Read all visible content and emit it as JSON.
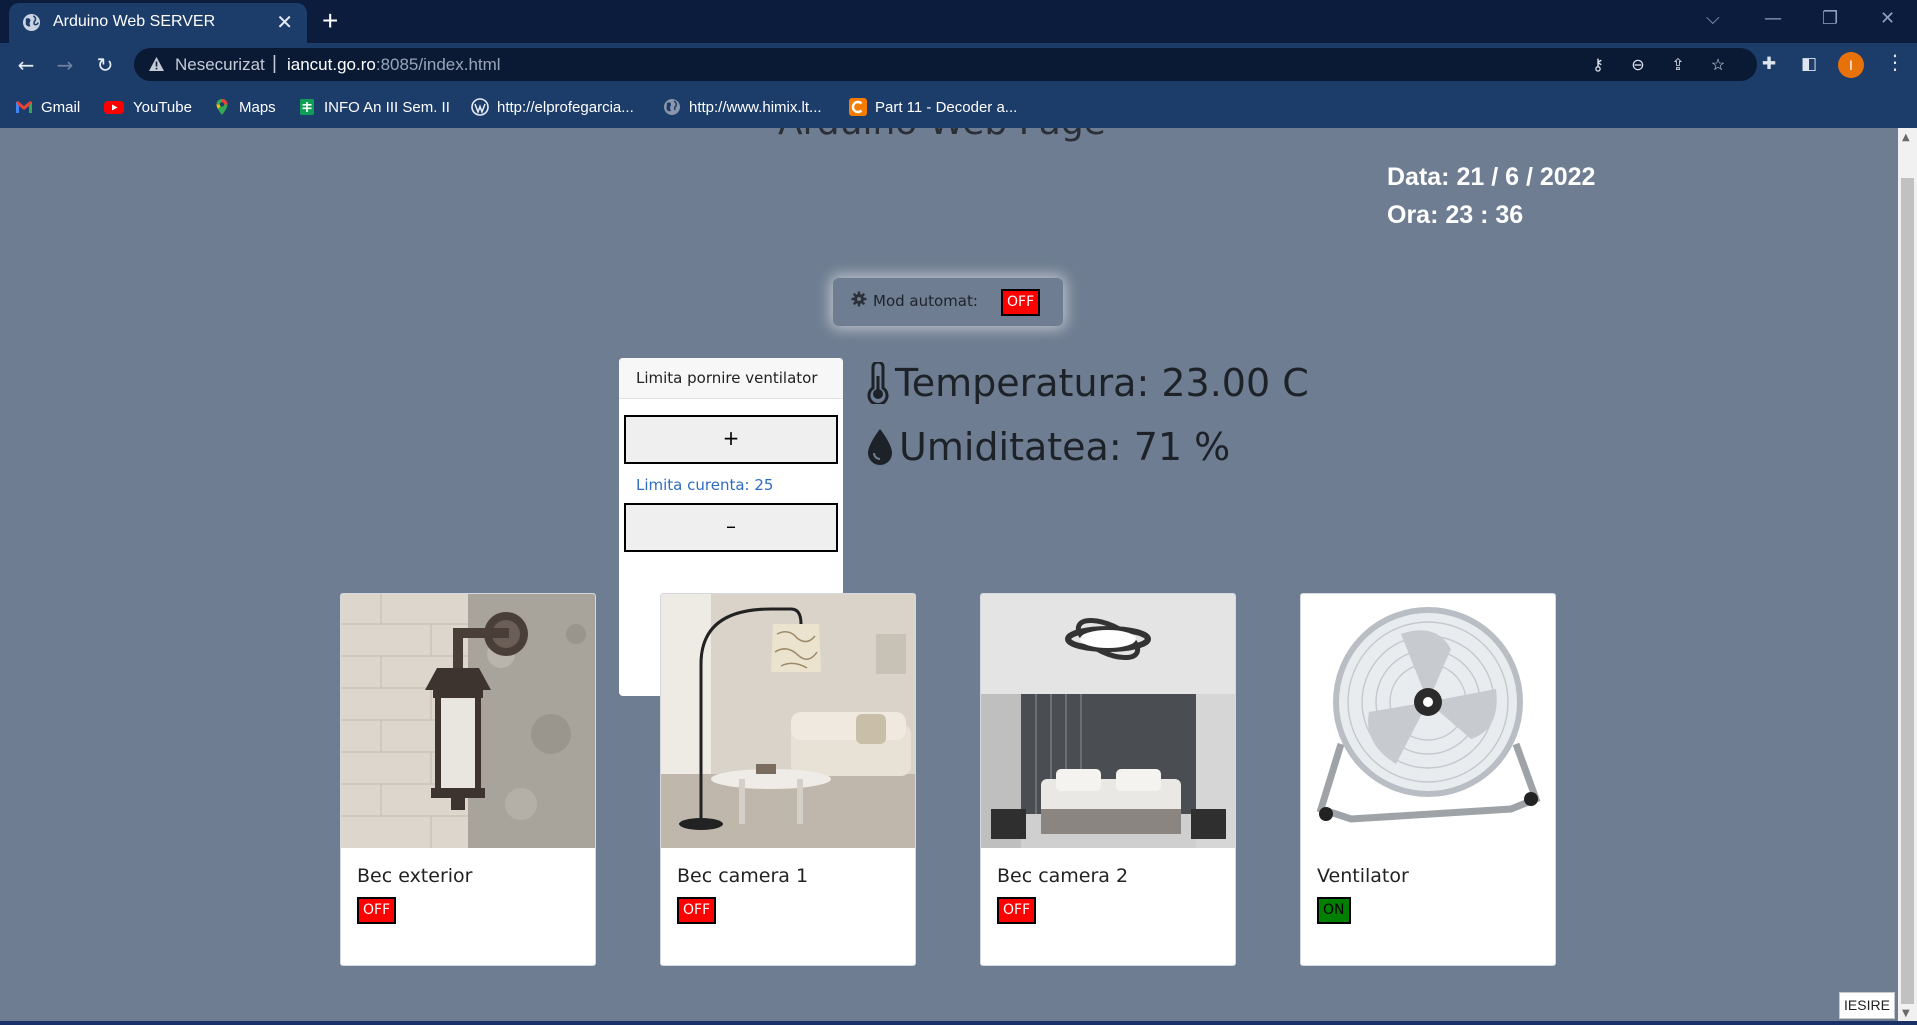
{
  "browser": {
    "tab_title": "Arduino Web SERVER",
    "tab_close": "✕",
    "new_tab": "+",
    "window_controls": {
      "list": "⌵",
      "minimize": "—",
      "restore": "❐",
      "close": "✕"
    },
    "security_label": "Nesecurizat",
    "url_host": "iancut.go.ro",
    "url_rest": ":8085/index.html",
    "profile_initial": "I",
    "bookmarks": [
      {
        "label": "Gmail",
        "icon": "gmail-icon"
      },
      {
        "label": "YouTube",
        "icon": "youtube-icon"
      },
      {
        "label": "Maps",
        "icon": "maps-icon"
      },
      {
        "label": "INFO An III Sem. II",
        "icon": "sheets-icon"
      },
      {
        "label": "http://elprofegarcia...",
        "icon": "wordpress-icon"
      },
      {
        "label": "http://www.himix.lt...",
        "icon": "globe-icon"
      },
      {
        "label": "Part 11 - Decoder a...",
        "icon": "c-site-icon"
      }
    ]
  },
  "page": {
    "heading": "Arduino Web Page",
    "date_line": "Data: 21 / 6 / 2022",
    "time_line": "Ora: 23 : 36",
    "auto_mode": {
      "label": "Mod automat:",
      "state": "OFF"
    },
    "fan_limit": {
      "title": "Limita pornire ventilator",
      "plus": "+",
      "minus": "–",
      "current": "Limita curenta: 25"
    },
    "temperature": "Temperatura: 23.00 C",
    "humidity": "Umiditatea: 71 %",
    "devices": [
      {
        "name": "Bec exterior",
        "state": "OFF",
        "image": "wall-lantern"
      },
      {
        "name": "Bec camera 1",
        "state": "OFF",
        "image": "arc-floor-lamp-living-room"
      },
      {
        "name": "Bec camera 2",
        "state": "OFF",
        "image": "bedroom-ceiling-light"
      },
      {
        "name": "Ventilator",
        "state": "ON",
        "image": "floor-fan"
      }
    ],
    "exit_label": "IESIRE"
  },
  "colors": {
    "page_bg": "#6e7d91",
    "state_off": "#ff0000",
    "state_on": "#008000",
    "limit_text": "#2f6cc3",
    "chrome_dark": "#0b1c3c",
    "chrome": "#1c3c6a"
  }
}
